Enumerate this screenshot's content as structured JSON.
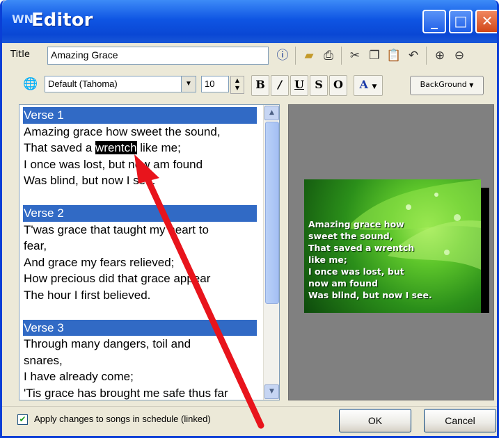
{
  "window": {
    "title": "Editor",
    "app_icon": "WN"
  },
  "toolbar1": {
    "title_label": "Title",
    "title_value": "Amazing Grace"
  },
  "toolbar2": {
    "font_value": "Default (Tahoma)",
    "size_value": "10",
    "bold_label": "B",
    "italic_label": "/",
    "underline_label": "U",
    "strike_label": "S",
    "outline_label": "O",
    "color_label": "A",
    "background_label": "BackGround"
  },
  "editor": {
    "verses": [
      {
        "heading": "Verse 1",
        "lines": [
          "Amazing grace how sweet the sound,",
          "That saved a",
          "wrentch",
          "like me;",
          "I once was lost, but now am found",
          "Was blind, but now I see."
        ]
      },
      {
        "heading": "Verse 2",
        "lines": [
          "T'was grace that taught my heart to",
          "fear,",
          "And grace my fears relieved;",
          "How precious did that grace appear",
          "The hour I first believed."
        ]
      },
      {
        "heading": "Verse 3",
        "lines": [
          "Through many dangers, toil and",
          "snares,",
          "I have already come;",
          "'Tis grace has brought me safe thus far"
        ]
      }
    ]
  },
  "preview": {
    "lines": [
      "Amazing grace how",
      "sweet the sound,",
      "That saved a wrentch",
      "like me;",
      "I once was lost, but",
      "now am found",
      "Was blind, but now I see."
    ]
  },
  "footer": {
    "apply_label": "Apply changes to songs in schedule (linked)",
    "ok_label": "OK",
    "cancel_label": "Cancel"
  }
}
